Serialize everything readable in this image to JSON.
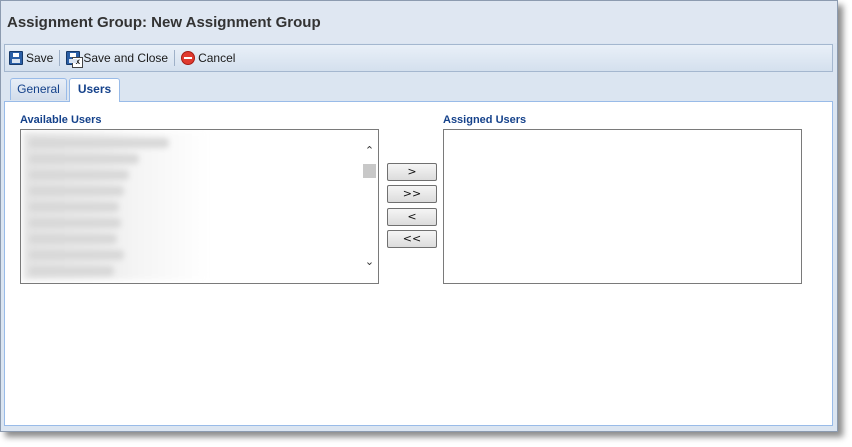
{
  "window": {
    "title": "Assignment Group: New Assignment Group"
  },
  "toolbar": {
    "save_label": "Save",
    "save_close_label": "Save and Close",
    "cancel_label": "Cancel"
  },
  "tabs": [
    {
      "label": "General",
      "active": false
    },
    {
      "label": "Users",
      "active": true
    }
  ],
  "available": {
    "label": "Available Users"
  },
  "assigned": {
    "label": "Assigned Users"
  },
  "move_buttons": {
    "add_selected": ">",
    "add_all": ">>",
    "remove_selected": "<",
    "remove_all": "<<"
  },
  "colors": {
    "accent": "#15428b",
    "border": "#99bbe8",
    "frame": "#dbe5f1"
  }
}
